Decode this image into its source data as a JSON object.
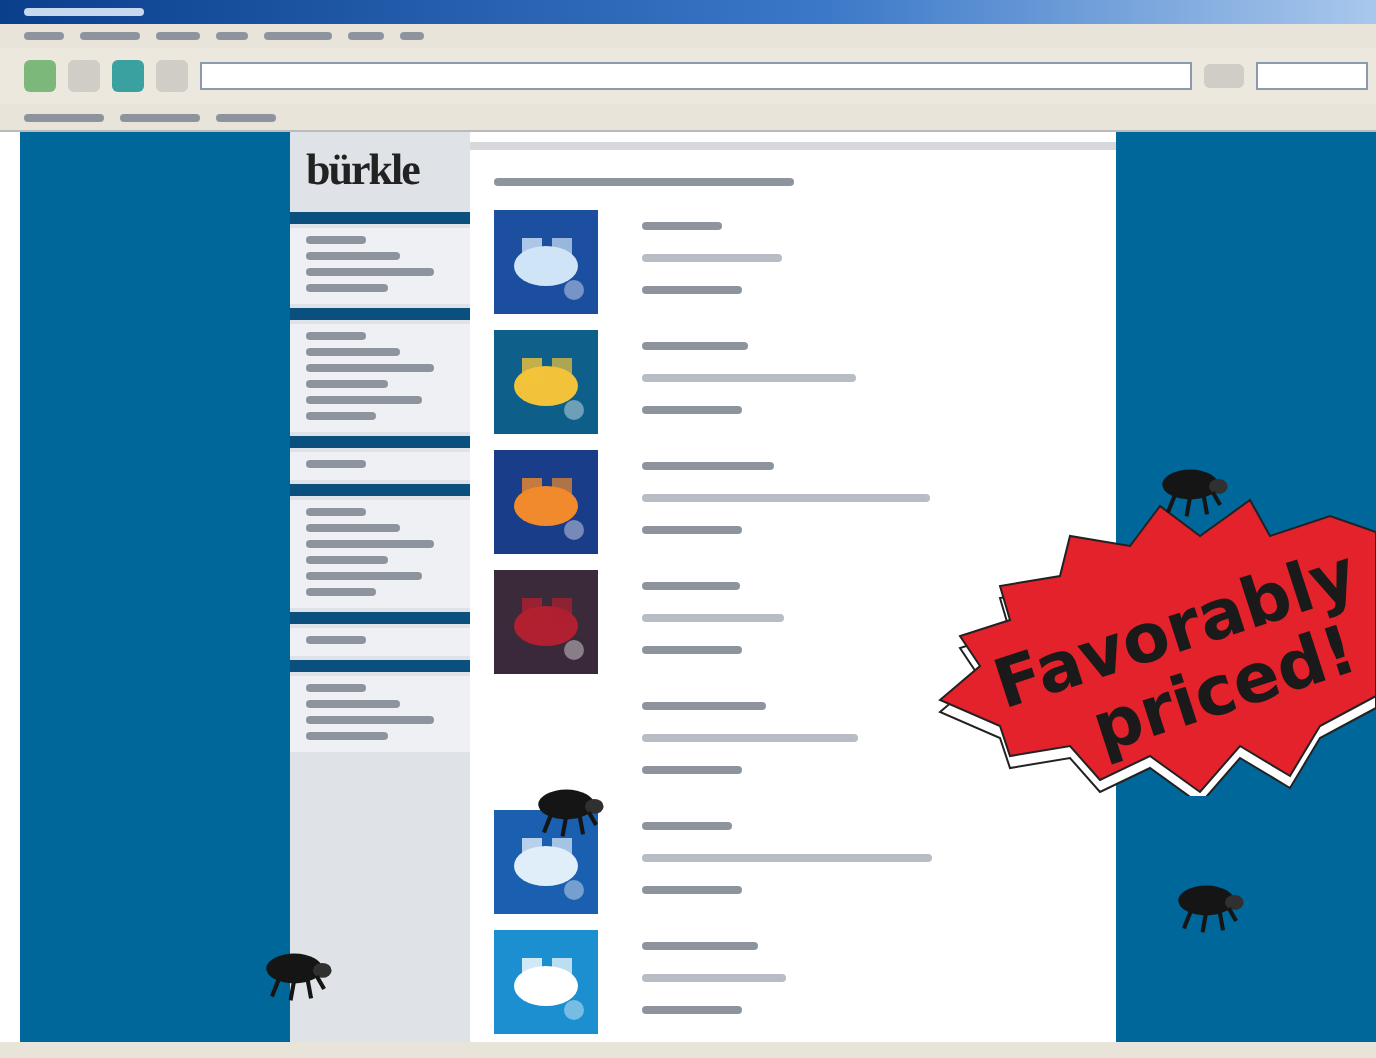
{
  "logo": "bürkle",
  "products": [
    {
      "kind": "picture"
    },
    {
      "kind": "picture"
    },
    {
      "kind": "picture"
    },
    {
      "kind": "picture"
    },
    {
      "kind": "text_only"
    },
    {
      "kind": "picture"
    },
    {
      "kind": "picture"
    }
  ],
  "badge": {
    "lines": [
      "Favorably",
      "priced!"
    ]
  }
}
